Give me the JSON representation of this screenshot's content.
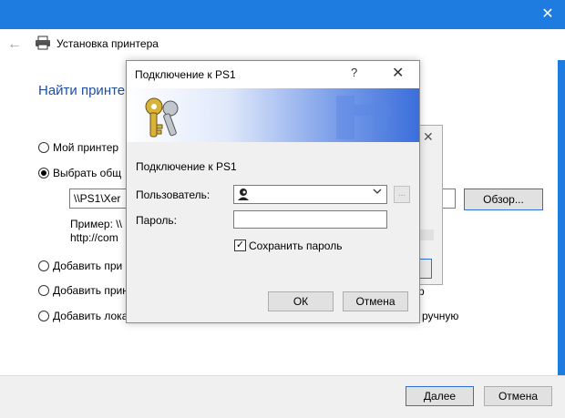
{
  "wizard": {
    "title": "Установка принтера",
    "heading": "Найти принте",
    "close_glyph": "✕",
    "back_glyph": "←",
    "options": [
      {
        "label": "Мой принтер",
        "checked": false
      },
      {
        "label": "Выбрать общ",
        "checked": true
      },
      {
        "label": "Добавить при",
        "checked": false
      },
      {
        "label": "Добавить прин",
        "checked": false
      },
      {
        "label": "Добавить лока",
        "checked": false
      }
    ],
    "path_value": "\\\\PS1\\Xer",
    "example": "Пример: \\\\\nhttp://com",
    "browse_label": "Обзор...",
    "next_label": "Далее",
    "cancel_label": "Отмена",
    "accent_color": "#1e7be0"
  },
  "middle_dialog": {
    "close_glyph": "✕",
    "fragment_r": "р",
    "fragment_manual": "ручную"
  },
  "credentials": {
    "title": "Подключение к PS1",
    "help_glyph": "?",
    "close_glyph": "✕",
    "subtitle": "Подключение к PS1",
    "user_label": "Пользователь:",
    "user_value": "",
    "browse_glyph": "...",
    "password_label": "Пароль:",
    "password_value": "",
    "save_password_label": "Сохранить пароль",
    "save_password_checked": true,
    "check_glyph": "✓",
    "ok_label": "ОК",
    "cancel_label": "Отмена",
    "banner_icon": "keys-icon"
  }
}
